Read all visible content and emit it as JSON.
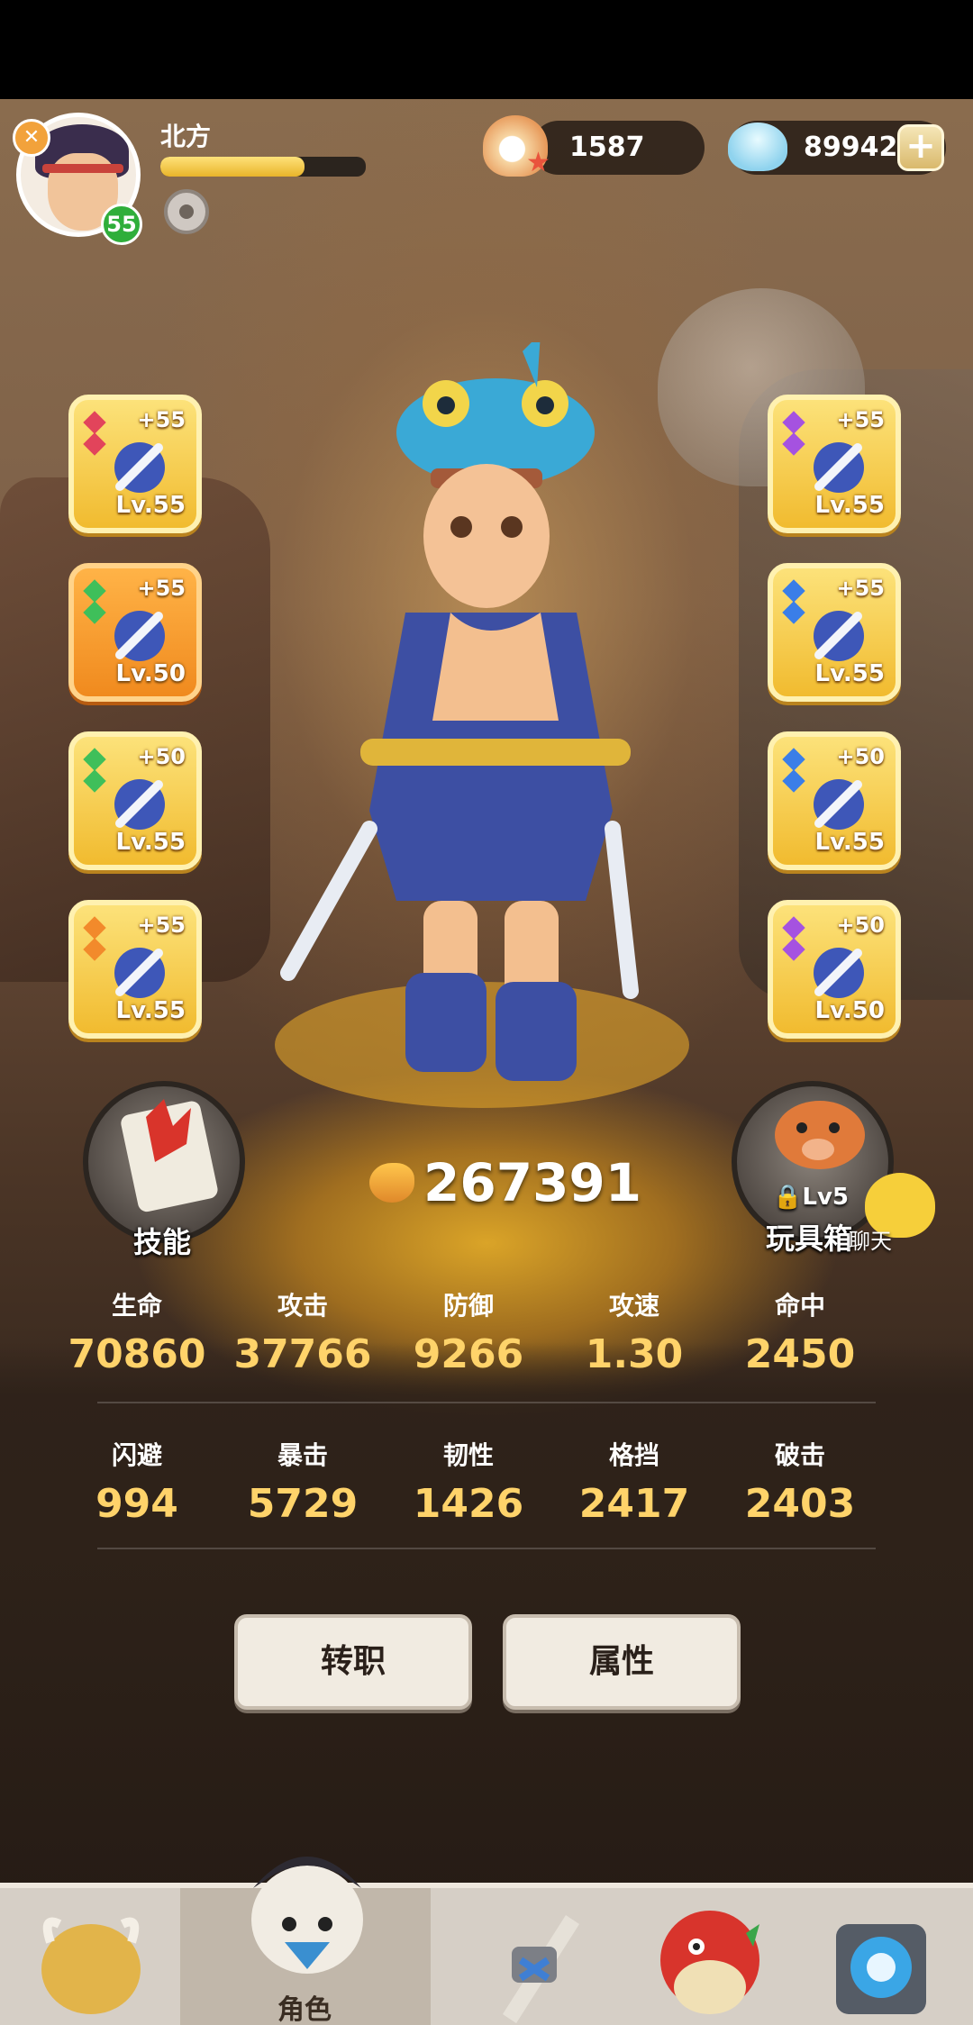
{
  "player": {
    "name": "北方",
    "level": "55",
    "exp_fraction": 0.7
  },
  "currency": {
    "pearls": "1587",
    "shells": "89942"
  },
  "equipment": {
    "left": [
      {
        "plus": "+55",
        "level": "Lv.55",
        "item": "spear-icon",
        "gem_color": "#e2445b"
      },
      {
        "plus": "+55",
        "level": "Lv.50",
        "item": "fish-helmet-icon",
        "gem_color": "#3fbf5a"
      },
      {
        "plus": "+50",
        "level": "Lv.55",
        "item": "claw-glove-icon",
        "gem_color": "#3fbf5a"
      },
      {
        "plus": "+55",
        "level": "Lv.55",
        "item": "ring-icon",
        "gem_color": "#f28a2b"
      }
    ],
    "right": [
      {
        "plus": "+55",
        "level": "Lv.55",
        "item": "spear-icon",
        "gem_color": "#a552e0"
      },
      {
        "plus": "+55",
        "level": "Lv.55",
        "item": "hood-icon",
        "gem_color": "#3a7ee8"
      },
      {
        "plus": "+50",
        "level": "Lv.55",
        "item": "armor-icon",
        "gem_color": "#3a7ee8"
      },
      {
        "plus": "+50",
        "level": "Lv.50",
        "item": "necklace-icon",
        "gem_color": "#a552e0"
      }
    ]
  },
  "power": "267391",
  "buttons": {
    "skills": "技能",
    "toys": "玩具箱",
    "toys_lock_level": "Lv5",
    "chat": "聊天",
    "job_change": "转职",
    "attributes": "属性"
  },
  "stats_row1": [
    {
      "label": "生命",
      "value": "70860"
    },
    {
      "label": "攻击",
      "value": "37766"
    },
    {
      "label": "防御",
      "value": "9266"
    },
    {
      "label": "攻速",
      "value": "1.30"
    },
    {
      "label": "命中",
      "value": "2450"
    }
  ],
  "stats_row2": [
    {
      "label": "闪避",
      "value": "994"
    },
    {
      "label": "暴击",
      "value": "5729"
    },
    {
      "label": "韧性",
      "value": "1426"
    },
    {
      "label": "格挡",
      "value": "2417"
    },
    {
      "label": "破击",
      "value": "2403"
    }
  ],
  "nav": {
    "items": [
      {
        "label": "",
        "icon": "mammoth-icon"
      },
      {
        "label": "角色",
        "icon": "character-icon"
      },
      {
        "label": "",
        "icon": "weapon-icon"
      },
      {
        "label": "",
        "icon": "pet-icon"
      },
      {
        "label": "",
        "icon": "portal-icon"
      }
    ]
  },
  "colors": {
    "stat_value": "#ffd36a",
    "slot_gold": "#f1bb2f",
    "slot_orange": "#f08a1e"
  }
}
